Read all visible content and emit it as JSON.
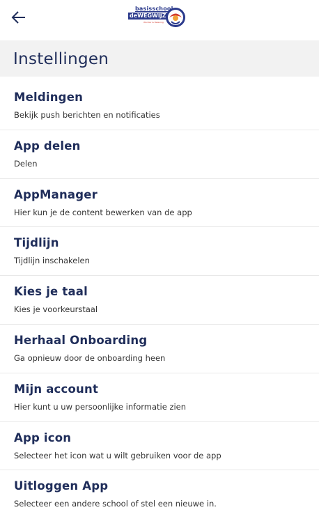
{
  "header": {
    "title": "Instellingen"
  },
  "logo": {
    "line1": "basisschool",
    "line2": "deWEGWIJZER",
    "line3": "Wonder & Beleving"
  },
  "icons": {
    "back": "arrow-left-icon",
    "logo": "school-logo"
  },
  "colors": {
    "primary_text": "#1f2d5a",
    "header_bg": "#f2f2f2",
    "divider": "#e8e8e8"
  },
  "settings": {
    "items": [
      {
        "title": "Meldingen",
        "subtitle": "Bekijk push berichten en notificaties"
      },
      {
        "title": "App delen",
        "subtitle": "Delen"
      },
      {
        "title": "AppManager",
        "subtitle": "Hier kun je de content bewerken van de app"
      },
      {
        "title": "Tijdlijn",
        "subtitle": "Tijdlijn inschakelen"
      },
      {
        "title": "Kies je taal",
        "subtitle": "Kies je voorkeurstaal"
      },
      {
        "title": "Herhaal Onboarding",
        "subtitle": "Ga opnieuw door de onboarding heen"
      },
      {
        "title": "Mijn account",
        "subtitle": "Hier kunt u uw persoonlijke informatie zien"
      },
      {
        "title": "App icon",
        "subtitle": "Selecteer het icon wat u wilt gebruiken voor de app"
      },
      {
        "title": "Uitloggen App",
        "subtitle": "Selecteer een andere school of stel een nieuwe in."
      }
    ]
  }
}
